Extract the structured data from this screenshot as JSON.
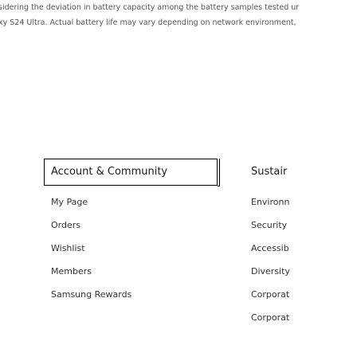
{
  "disclaimer": {
    "line1": "sidering the deviation in battery capacity among the battery samples tested ur",
    "line2": "xy S24 Ultra. Actual battery life may vary depending on network environment,"
  },
  "footer": {
    "account_section": {
      "heading": "Account & Community",
      "items": [
        "My Page",
        "Orders",
        "Wishlist",
        "Members",
        "Samsung Rewards"
      ]
    },
    "sustain_section": {
      "heading": "Sustair",
      "items": [
        "Environn",
        "Security",
        "Accessib",
        "Diversity",
        "Corporat",
        "Corporat"
      ]
    }
  }
}
